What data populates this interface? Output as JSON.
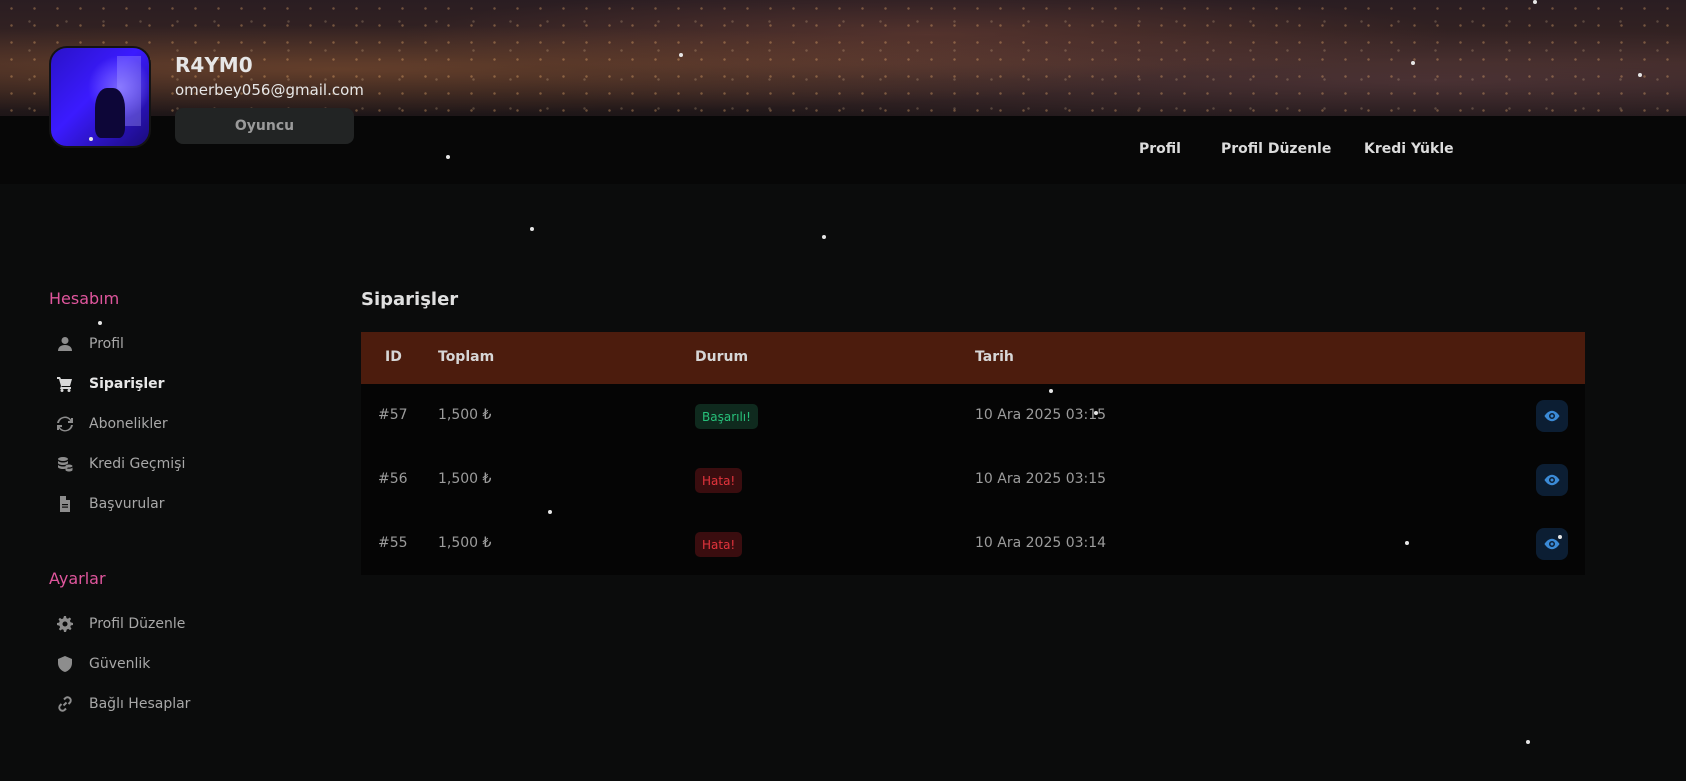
{
  "profile": {
    "username": "R4YM0",
    "email": "omerbey056@gmail.com",
    "role": "Oyuncu"
  },
  "topnav": {
    "items": [
      "Profil",
      "Profil Düzenle",
      "Kredi Yükle"
    ]
  },
  "sidebar": {
    "account_heading": "Hesabım",
    "account_items": [
      {
        "label": "Profil",
        "icon": "user-icon"
      },
      {
        "label": "Siparişler",
        "icon": "cart-icon"
      },
      {
        "label": "Abonelikler",
        "icon": "refresh-icon"
      },
      {
        "label": "Kredi Geçmişi",
        "icon": "coins-icon"
      },
      {
        "label": "Başvurular",
        "icon": "file-icon"
      }
    ],
    "settings_heading": "Ayarlar",
    "settings_items": [
      {
        "label": "Profil Düzenle",
        "icon": "gear-icon"
      },
      {
        "label": "Güvenlik",
        "icon": "shield-icon"
      },
      {
        "label": "Bağlı Hesaplar",
        "icon": "link-icon"
      }
    ]
  },
  "orders": {
    "title": "Siparişler",
    "columns": [
      "ID",
      "Toplam",
      "Durum",
      "Tarih"
    ],
    "rows": [
      {
        "id": "#57",
        "total": "1,500 ₺",
        "status": "Başarılı!",
        "date": "10 Ara 2025 03:15"
      },
      {
        "id": "#56",
        "total": "1,500 ₺",
        "status": "Hata!",
        "date": "10 Ara 2025 03:15"
      },
      {
        "id": "#55",
        "total": "1,500 ₺",
        "status": "Hata!",
        "date": "10 Ara 2025 03:14"
      }
    ]
  },
  "colors": {
    "accent": "#e0569d",
    "table_header": "#4c1c0d",
    "success": "#27c07a",
    "error": "#e2343c",
    "view_icon": "#3b8ad6"
  }
}
